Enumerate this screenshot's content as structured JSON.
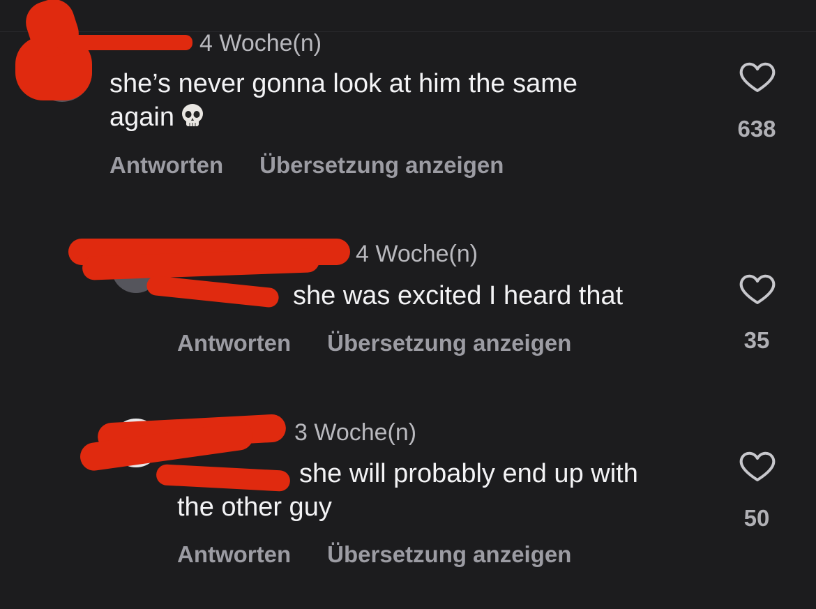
{
  "comments": [
    {
      "time": "4 Woche(n)",
      "text_line1": "she’s never gonna look at him the same",
      "text_line2": "again",
      "emoji": "skull-emoji",
      "reply_label": "Antworten",
      "translate_label": "Übersetzung anzeigen",
      "likes": "638"
    },
    {
      "time": "4 Woche(n)",
      "text": "she was excited I heard that",
      "reply_label": "Antworten",
      "translate_label": "Übersetzung anzeigen",
      "likes": "35"
    },
    {
      "time": "3 Woche(n)",
      "text_line1": "she will probably end up with",
      "text_line2": "the other guy",
      "reply_label": "Antworten",
      "translate_label": "Übersetzung anzeigen",
      "likes": "50"
    }
  ],
  "colors": {
    "background": "#1c1c1e",
    "redaction": "#e02a0f",
    "mention": "#8b86e8"
  }
}
